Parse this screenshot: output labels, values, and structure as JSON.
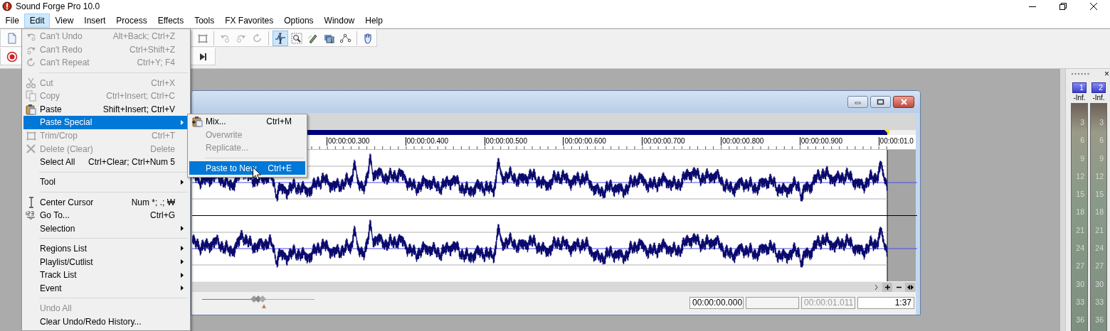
{
  "window": {
    "title": "Sound Forge Pro 10.0"
  },
  "menubar": [
    {
      "label": "File",
      "selected": false
    },
    {
      "label": "Edit",
      "selected": true
    },
    {
      "label": "View",
      "selected": false
    },
    {
      "label": "Insert",
      "selected": false
    },
    {
      "label": "Process",
      "selected": false
    },
    {
      "label": "Effects",
      "selected": false
    },
    {
      "label": "Tools",
      "selected": false
    },
    {
      "label": "FX Favorites",
      "selected": false
    },
    {
      "label": "Options",
      "selected": false
    },
    {
      "label": "Window",
      "selected": false
    },
    {
      "label": "Help",
      "selected": false
    }
  ],
  "toolbar": {
    "tools": [
      {
        "selected": true
      },
      {
        "selected": false
      },
      {
        "selected": false
      },
      {
        "selected": false
      },
      {
        "selected": false
      }
    ]
  },
  "edit_menu": [
    {
      "kind": "item",
      "label": "Can't Undo",
      "shortcut": "Alt+Back; Ctrl+Z",
      "disabled": true,
      "selected": false
    },
    {
      "kind": "item",
      "label": "Can't Redo",
      "shortcut": "Ctrl+Shift+Z",
      "disabled": true,
      "selected": false
    },
    {
      "kind": "item",
      "label": "Can't Repeat",
      "shortcut": "Ctrl+Y; F4",
      "disabled": true,
      "selected": false
    },
    {
      "kind": "separator"
    },
    {
      "kind": "item",
      "label": "Cut",
      "shortcut": "Ctrl+X",
      "disabled": true,
      "selected": false
    },
    {
      "kind": "item",
      "label": "Copy",
      "shortcut": "Ctrl+Insert; Ctrl+C",
      "disabled": true,
      "selected": false
    },
    {
      "kind": "item",
      "label": "Paste",
      "shortcut": "Shift+Insert; Ctrl+V",
      "disabled": false,
      "selected": false
    },
    {
      "kind": "submenu",
      "label": "Paste Special",
      "disabled": false,
      "selected": true
    },
    {
      "kind": "item",
      "label": "Trim/Crop",
      "shortcut": "Ctrl+T",
      "disabled": true,
      "selected": false
    },
    {
      "kind": "item",
      "label": "Delete (Clear)",
      "shortcut": "Delete",
      "disabled": true,
      "selected": false
    },
    {
      "kind": "item",
      "label": "Select All",
      "shortcut": "Ctrl+Clear; Ctrl+Num 5",
      "disabled": false,
      "selected": false
    },
    {
      "kind": "separator"
    },
    {
      "kind": "submenu",
      "label": "Tool",
      "disabled": false,
      "selected": false
    },
    {
      "kind": "separator"
    },
    {
      "kind": "item",
      "label": "Center Cursor",
      "shortcut": "Num *; .; ₩",
      "disabled": false,
      "selected": false
    },
    {
      "kind": "item",
      "label": "Go To...",
      "shortcut": "Ctrl+G",
      "disabled": false,
      "selected": false
    },
    {
      "kind": "submenu",
      "label": "Selection",
      "disabled": false,
      "selected": false
    },
    {
      "kind": "separator"
    },
    {
      "kind": "submenu",
      "label": "Regions List",
      "disabled": false,
      "selected": false
    },
    {
      "kind": "submenu",
      "label": "Playlist/Cutlist",
      "disabled": false,
      "selected": false
    },
    {
      "kind": "submenu",
      "label": "Track List",
      "disabled": false,
      "selected": false
    },
    {
      "kind": "submenu",
      "label": "Event",
      "disabled": false,
      "selected": false
    },
    {
      "kind": "separator"
    },
    {
      "kind": "item",
      "label": "Undo All",
      "disabled": true,
      "selected": false
    },
    {
      "kind": "item",
      "label": "Clear Undo/Redo History...",
      "disabled": false,
      "selected": false
    }
  ],
  "paste_special_menu": [
    {
      "kind": "item",
      "label": "Mix...",
      "shortcut": "Ctrl+M",
      "disabled": false,
      "selected": false
    },
    {
      "kind": "item",
      "label": "Overwrite",
      "disabled": true,
      "selected": false
    },
    {
      "kind": "item",
      "label": "Replicate...",
      "disabled": true,
      "selected": false
    },
    {
      "kind": "separator"
    },
    {
      "kind": "item",
      "label": "Paste to New",
      "shortcut": "Ctrl+E",
      "disabled": false,
      "selected": true
    }
  ],
  "data_window": {
    "ruler": [
      "00:00:00.300",
      "00:00:00.400",
      "00:00:00.500",
      "00:00:00.600",
      "00:00:00.700",
      "00:00:00.800",
      "00:00:00.900",
      "00:00:01.0"
    ],
    "zoom_slider": {
      "level": 0.5
    },
    "fields": [
      {
        "value": "00:00:00.000",
        "disabled": false
      },
      {
        "value": "00:00:01.011",
        "disabled": true
      },
      {
        "value": "1:37",
        "disabled": false
      }
    ]
  },
  "meters": {
    "close": "×",
    "channels": [
      {
        "label": "1",
        "reading": "-Inf.",
        "scale": [
          "3",
          "6",
          "9",
          "12",
          "15",
          "18",
          "21",
          "24",
          "27",
          "30",
          "33",
          "36"
        ]
      },
      {
        "label": "2",
        "reading": "-Inf.",
        "scale": [
          "3",
          "6",
          "9",
          "12",
          "15",
          "18",
          "21",
          "24",
          "27",
          "30",
          "33",
          "36"
        ]
      }
    ]
  }
}
